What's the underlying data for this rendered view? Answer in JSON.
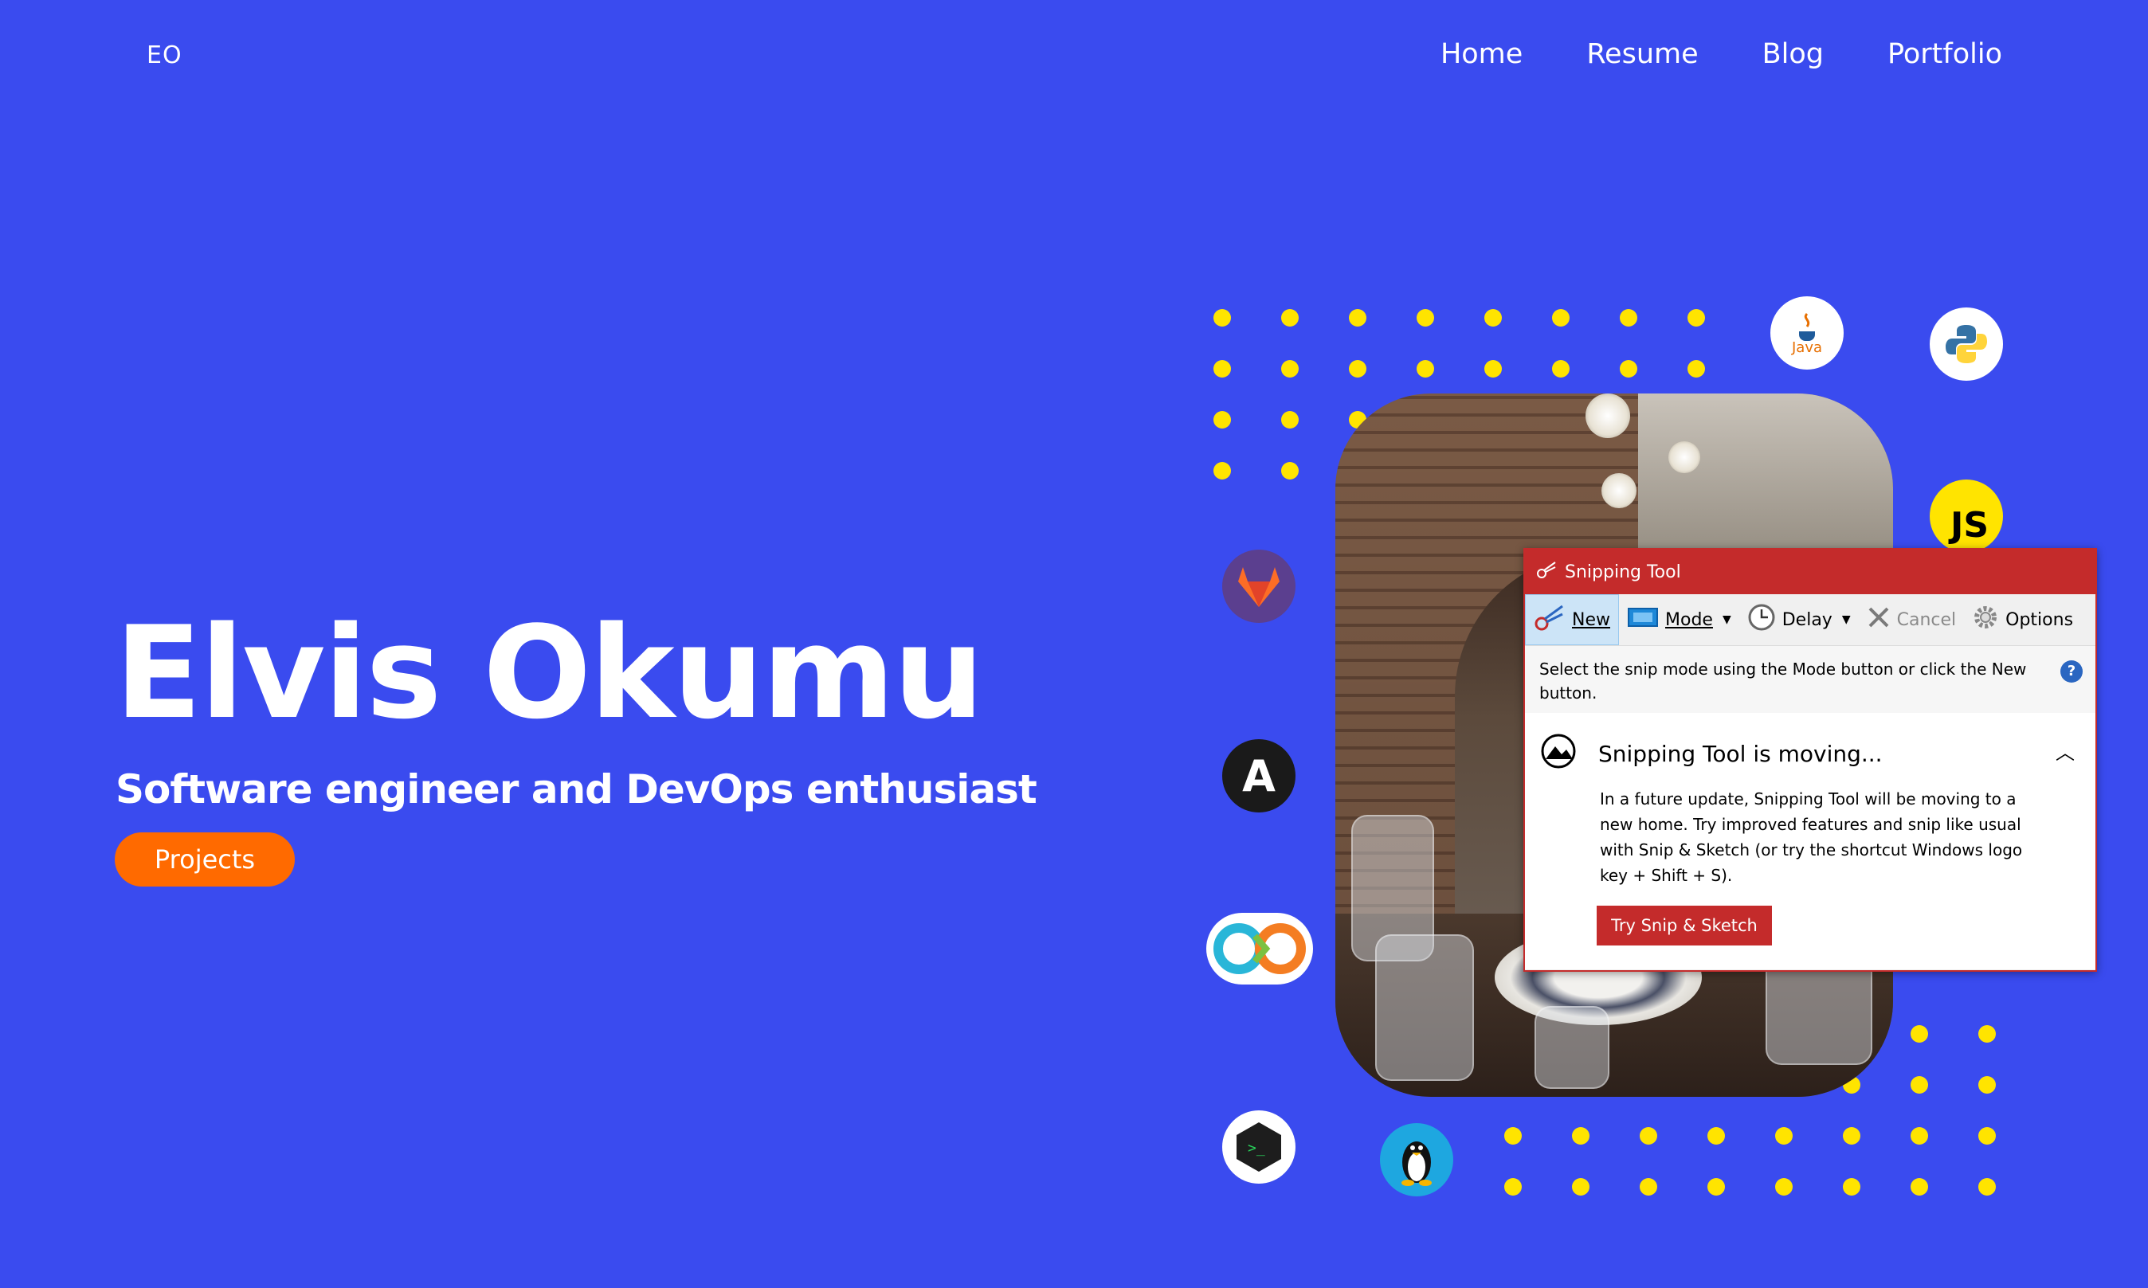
{
  "brand": {
    "logo": "EO"
  },
  "nav": {
    "items": [
      "Home",
      "Resume",
      "Blog",
      "Portfolio"
    ]
  },
  "hero": {
    "name": "Elvis Okumu",
    "subtitle": "Software engineer and DevOps enthusiast",
    "cta": "Projects"
  },
  "tech_icons": {
    "java_label": "Java",
    "js_label": "JS",
    "terminal_label": ">_",
    "ansible_label": "A"
  },
  "snipping_tool": {
    "title": "Snipping Tool",
    "toolbar": {
      "new": "New",
      "mode": "Mode",
      "delay": "Delay",
      "cancel": "Cancel",
      "options": "Options"
    },
    "instruction": "Select the snip mode using the Mode button or click the New button.",
    "help": "?",
    "notice_title": "Snipping Tool is moving...",
    "notice_body": "In a future update, Snipping Tool will be moving to a new home. Try improved features and snip like usual with Snip & Sketch (or try the shortcut Windows logo key + Shift + S).",
    "try_button": "Try Snip & Sketch"
  },
  "colors": {
    "background": "#3a4bef",
    "accent": "#ff6a00",
    "dots": "#ffe400",
    "snip_red": "#c42b2b"
  }
}
